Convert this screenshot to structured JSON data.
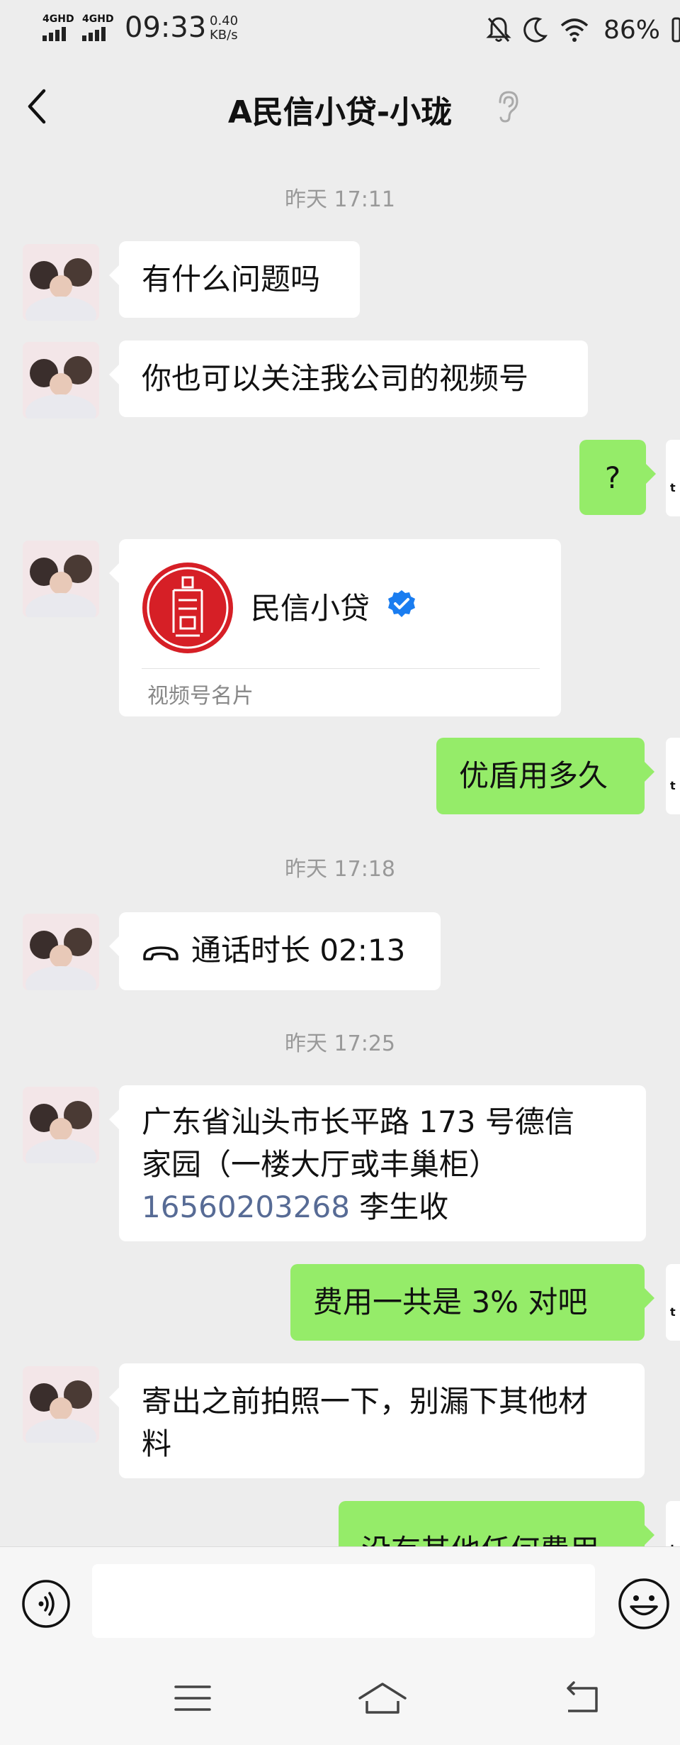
{
  "status_bar": {
    "sim1": "4GHD",
    "sim2": "4GHD",
    "time": "09:33",
    "net_speed_value": "0.40",
    "net_speed_unit": "KB/s",
    "battery": "86%"
  },
  "header": {
    "title": "A民信小贷-小珑"
  },
  "chat": {
    "timestamps": [
      "昨天 17:11",
      "昨天 17:18",
      "昨天 17:25"
    ],
    "messages": [
      {
        "side": "in",
        "text": "有什么问题吗"
      },
      {
        "side": "in",
        "text": "你也可以关注我公司的视频号"
      },
      {
        "side": "out",
        "text": "?"
      },
      {
        "side": "in",
        "type": "card",
        "card_name": "民信小贷",
        "card_type": "视频号名片"
      },
      {
        "side": "out",
        "text": "优盾用多久"
      },
      {
        "side": "in",
        "type": "call",
        "text": "通话时长 02:13"
      },
      {
        "side": "in",
        "line1": "广东省汕头市长平路 173 号德信",
        "line2": "家园（一楼大厅或丰巢柜）",
        "phone": "16560203268",
        "suffix": " 李生收"
      },
      {
        "side": "out",
        "text": "费用一共是 3%  对吧"
      },
      {
        "side": "in",
        "line1": "寄出之前拍照一下，别漏下其他材",
        "line2": "料"
      },
      {
        "side": "out",
        "text": "没有其他任何费用"
      }
    ]
  },
  "icons": {
    "back": "back-arrow-icon",
    "ear": "ear-icon",
    "voice": "voice-input-icon",
    "emoji": "emoji-icon",
    "verified": "verified-badge-icon",
    "call": "phone-hangup-icon"
  },
  "colors": {
    "background": "#ededed",
    "outgoing_bubble": "#95ec69",
    "incoming_bubble": "#ffffff",
    "link": "#576b95",
    "verified": "#1a7df0",
    "logo_red": "#d61f26"
  }
}
